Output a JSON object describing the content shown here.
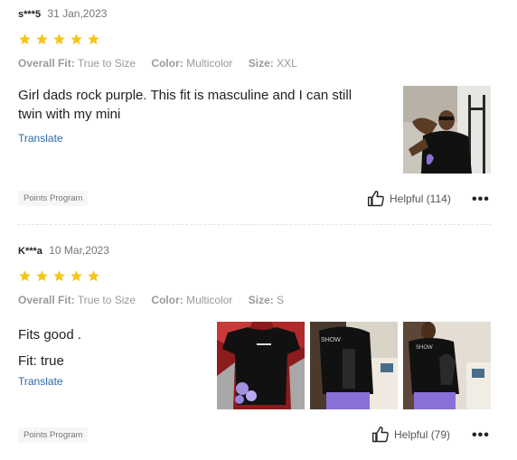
{
  "reviews": [
    {
      "user": "s***5",
      "date": "31 Jan,2023",
      "rating": 5,
      "fit_label": "Overall Fit:",
      "fit_value": "True to Size",
      "color_label": "Color:",
      "color_value": "Multicolor",
      "size_label": "Size:",
      "size_value": "XXL",
      "text_line1": "Girl dads rock purple. This fit is masculine and I can still",
      "text_line2": "twin with my mini",
      "translate": "Translate",
      "badge": "Points Program",
      "helpful": "Helpful (114)",
      "more": "•••"
    },
    {
      "user": "K***a",
      "date": "10 Mar,2023",
      "rating": 5,
      "fit_label": "Overall Fit:",
      "fit_value": "True to Size",
      "color_label": "Color:",
      "color_value": "Multicolor",
      "size_label": "Size:",
      "size_value": "S",
      "text_line1": "Fits good .",
      "text_line2": "Fit: true",
      "translate": "Translate",
      "badge": "Points Program",
      "helpful": "Helpful (79)",
      "more": "•••"
    }
  ],
  "colors": {
    "star": "#f5c518",
    "link": "#2d68a8",
    "shirt": "#111111",
    "shorts": "#8a6fd6"
  }
}
